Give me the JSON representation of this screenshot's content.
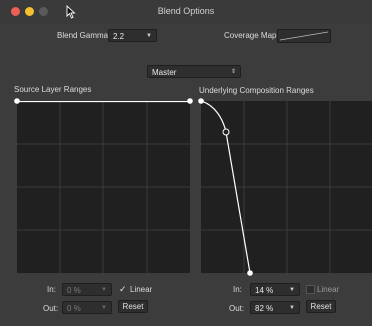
{
  "window": {
    "title": "Blend Options"
  },
  "header": {
    "blend_gamma_label": "Blend Gamma:",
    "blend_gamma_value": "2.2",
    "coverage_map_label": "Coverage Map:"
  },
  "channel": {
    "selected": "Master"
  },
  "source": {
    "title": "Source Layer Ranges",
    "in_label": "In:",
    "in_value": "0 %",
    "out_label": "Out:",
    "out_value": "0 %",
    "linear_label": "Linear",
    "linear_checked": true,
    "reset_label": "Reset"
  },
  "underlying": {
    "title": "Underlying Composition Ranges",
    "in_label": "In:",
    "in_value": "14 %",
    "out_label": "Out:",
    "out_value": "82 %",
    "linear_label": "Linear",
    "linear_checked": false,
    "reset_label": "Reset"
  },
  "colors": {
    "graph_bg": "#202020",
    "grid": "#3a3a3a",
    "curve": "#ffffff"
  }
}
